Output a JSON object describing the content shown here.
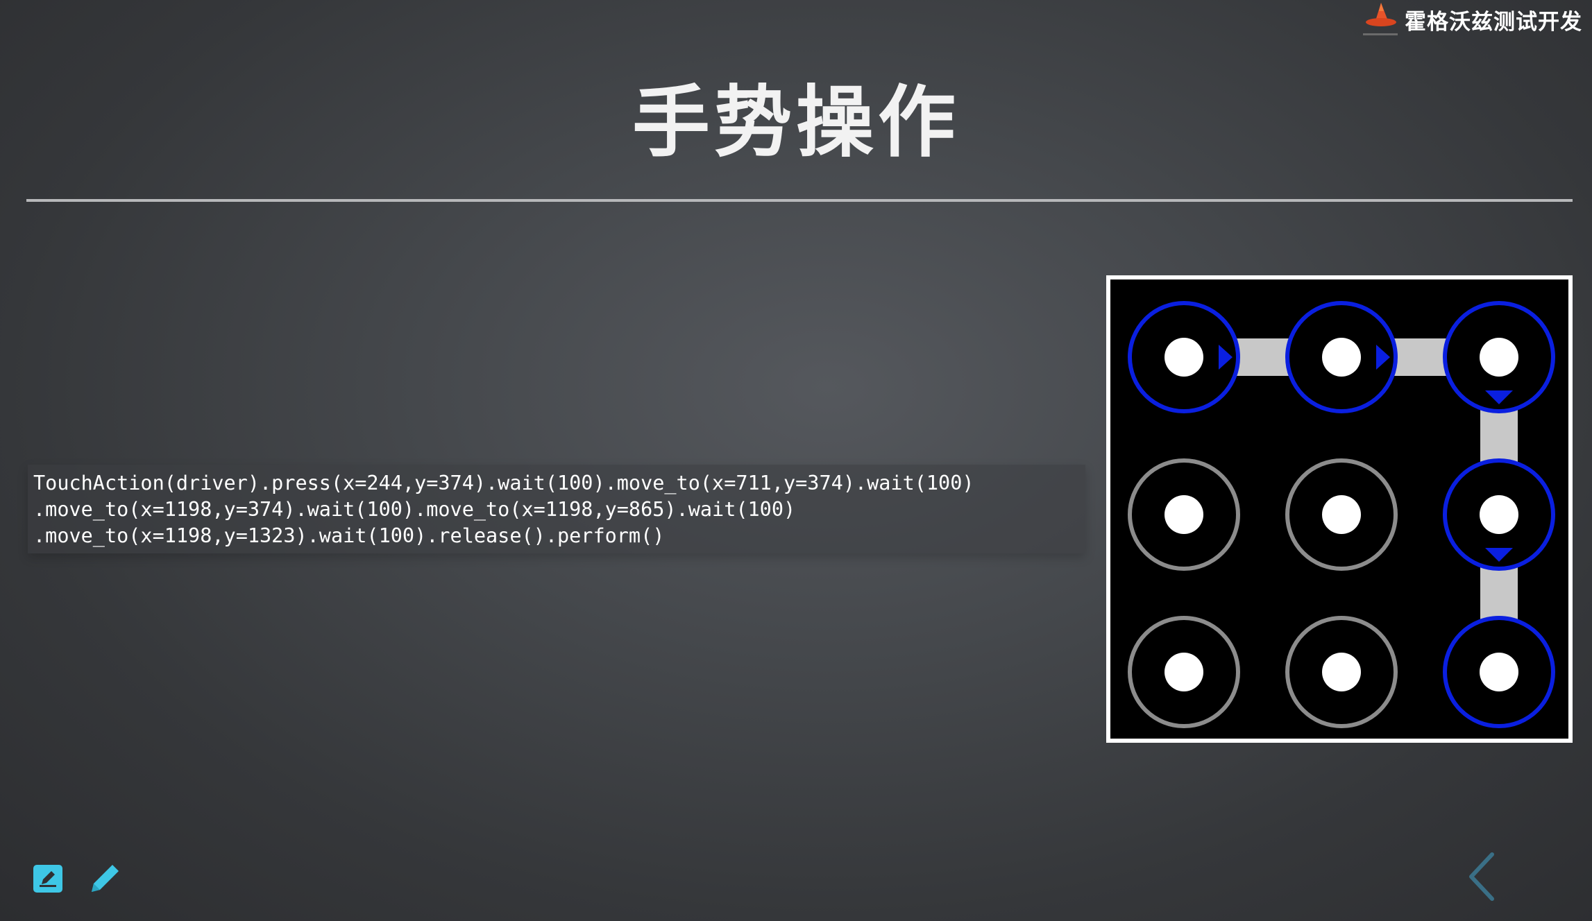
{
  "brand": {
    "name": "霍格沃兹测试开发",
    "logo_icon": "wizard-hat-icon"
  },
  "slide": {
    "title": "手势操作"
  },
  "code": {
    "lines": [
      "TouchAction(driver).press(x=244,y=374).wait(100).move_to(x=711,y=374).wait(100)",
      ".move_to(x=1198,y=374).wait(100).move_to(x=1198,y=865).wait(100)",
      ".move_to(x=1198,y=1323).wait(100).release().perform()"
    ]
  },
  "pattern_lock": {
    "grid": "3x3",
    "path_nodes": [
      1,
      2,
      3,
      6,
      9
    ],
    "colors": {
      "active_ring": "#0a1fe0",
      "inactive_ring": "#8c8c8c",
      "connector": "#c8c8c8",
      "dot": "#ffffff",
      "background": "#000000"
    }
  },
  "toolbar": {
    "icons": [
      "edit-note-icon",
      "pencil-icon"
    ]
  },
  "navigation": {
    "back_icon": "chevron-left-icon"
  },
  "colors": {
    "accent": "#3ec7e6",
    "nav": "#3a6f86"
  }
}
